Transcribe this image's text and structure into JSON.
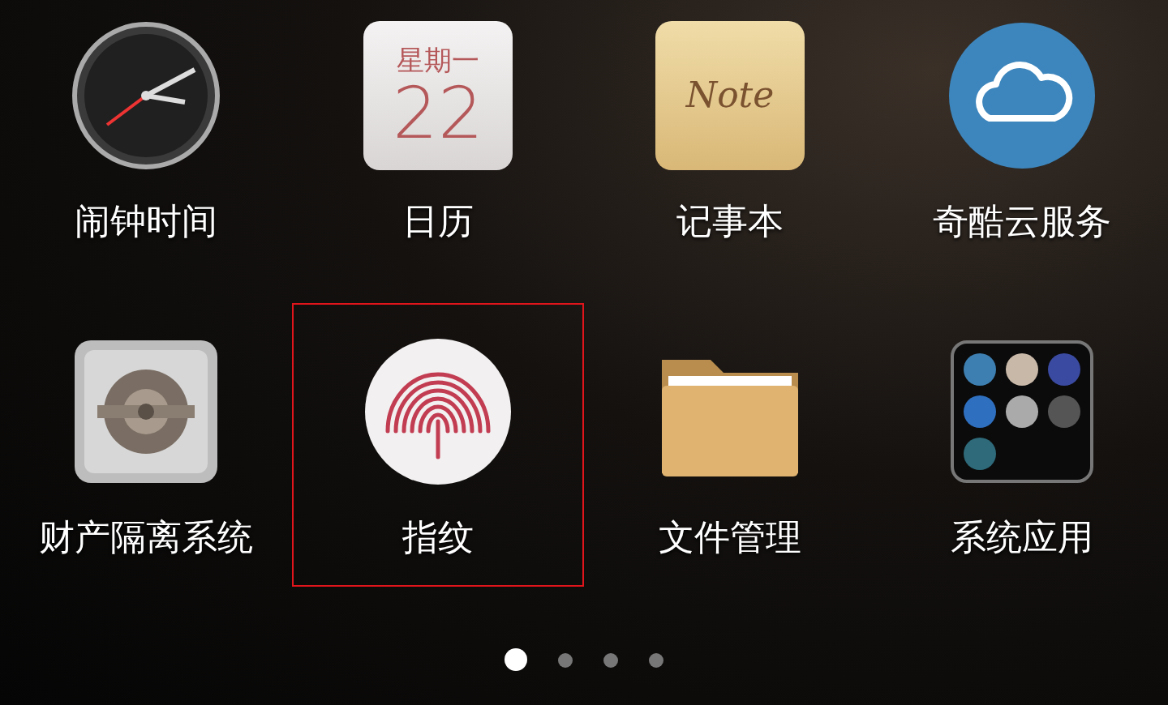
{
  "apps": [
    {
      "kind": "clock",
      "label": "闹钟时间",
      "selected": false
    },
    {
      "kind": "calendar",
      "label": "日历",
      "weekday": "星期一",
      "day": "22",
      "selected": false
    },
    {
      "kind": "note",
      "label": "记事本",
      "note": "Note",
      "selected": false
    },
    {
      "kind": "cloud",
      "label": "奇酷云服务",
      "selected": false
    },
    {
      "kind": "safe",
      "label": "财产隔离系统",
      "selected": false
    },
    {
      "kind": "fingerprint",
      "label": "指纹",
      "selected": true
    },
    {
      "kind": "folder",
      "label": "文件管理",
      "selected": false
    },
    {
      "kind": "appfolder",
      "label": "系统应用",
      "selected": false
    }
  ],
  "pages": [
    {
      "selected": true
    },
    {
      "selected": false
    },
    {
      "selected": false
    },
    {
      "selected": false
    }
  ]
}
